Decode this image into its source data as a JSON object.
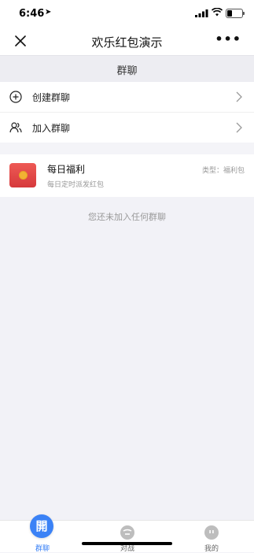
{
  "status_bar": {
    "time": "6:46",
    "location_glyph": "➤"
  },
  "nav": {
    "title": "欢乐红包演示",
    "more_label": "•••"
  },
  "page": {
    "title": "群聊"
  },
  "menu": [
    {
      "label": "创建群聊",
      "icon": "add-circle-icon"
    },
    {
      "label": "加入群聊",
      "icon": "people-icon"
    }
  ],
  "group": {
    "name": "每日福利",
    "desc": "每日定时派发红包",
    "type": "类型：福利包",
    "icon": "red-envelope-icon"
  },
  "empty_text": "您还未加入任何群聊",
  "tabs": [
    {
      "label": "群聊",
      "icon_glyph": "開",
      "active": true
    },
    {
      "label": "对战",
      "active": false
    },
    {
      "label": "我的",
      "active": false
    }
  ],
  "colors": {
    "accent": "#3b82f6",
    "red_envelope": "#e24a48",
    "background": "#f2f2f7"
  }
}
